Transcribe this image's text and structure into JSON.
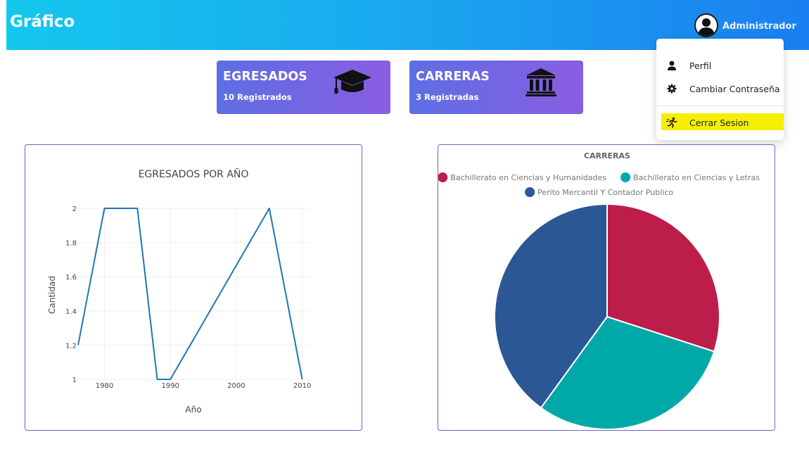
{
  "header": {
    "title": "Gráfico",
    "user_name": "Administrador"
  },
  "user_menu": {
    "items": [
      {
        "label": "Perfil",
        "icon": "user-icon"
      },
      {
        "label": "Cambiar Contraseña",
        "icon": "gear-icon"
      },
      {
        "label": "Cerrar Sesion",
        "icon": "running-icon",
        "highlighted": true
      }
    ]
  },
  "cards": [
    {
      "title": "EGRESADOS",
      "subtitle": "10 Registrados",
      "icon": "graduation-cap-icon"
    },
    {
      "title": "CARRERAS",
      "subtitle": "3 Registradas",
      "icon": "university-icon"
    }
  ],
  "chart_data": [
    {
      "type": "line",
      "title": "EGRESADOS POR AÑO",
      "xlabel": "Año",
      "ylabel": "Cantidad",
      "x": [
        1976,
        1980,
        1985,
        1988,
        1990,
        2005,
        2010
      ],
      "y": [
        1.2,
        2,
        2,
        1,
        1,
        2,
        1
      ],
      "xlim": [
        1976,
        2011
      ],
      "ylim": [
        1,
        2
      ],
      "x_ticks": [
        "1980",
        "1990",
        "2000",
        "2010"
      ],
      "y_ticks": [
        "1",
        "1.2",
        "1.4",
        "1.6",
        "1.8",
        "2"
      ],
      "line_color": "#1f77b4",
      "grid": true
    },
    {
      "type": "pie",
      "title": "CARRERAS",
      "legend_position": "top",
      "slices": [
        {
          "label": "Bachillerato en Ciencias y Humanidades",
          "value": 3,
          "color": "#bd1d4a"
        },
        {
          "label": "Bachillerato en Ciencias y Letras",
          "value": 3,
          "color": "#00a9a8"
        },
        {
          "label": "Perito Mercantil Y Contador Publico",
          "value": 4,
          "color": "#2b5795"
        }
      ]
    }
  ]
}
